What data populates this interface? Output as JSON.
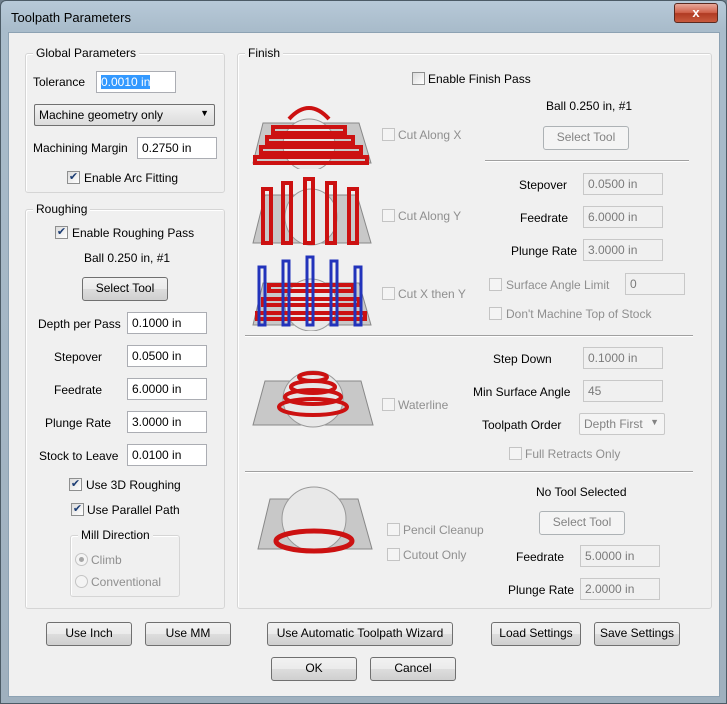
{
  "window": {
    "title": "Toolpath Parameters",
    "close_glyph": "x"
  },
  "global": {
    "title": "Global Parameters",
    "tolerance_label": "Tolerance",
    "tolerance_value": "0.0010 in",
    "geometry_select": "Machine geometry only",
    "margin_label": "Machining Margin",
    "margin_value": "0.2750 in",
    "arc_fitting_label": "Enable Arc Fitting",
    "arc_fitting_checked": true
  },
  "roughing": {
    "title": "Roughing",
    "enable_label": "Enable Roughing Pass",
    "enable_checked": true,
    "tool_name": "Ball 0.250 in, #1",
    "select_tool_label": "Select Tool",
    "depth_label": "Depth per Pass",
    "depth_value": "0.1000 in",
    "stepover_label": "Stepover",
    "stepover_value": "0.0500 in",
    "feedrate_label": "Feedrate",
    "feedrate_value": "6.0000 in",
    "plunge_label": "Plunge Rate",
    "plunge_value": "3.0000 in",
    "stock_label": "Stock to Leave",
    "stock_value": "0.0100 in",
    "use3d_label": "Use 3D Roughing",
    "use3d_checked": true,
    "parallel_label": "Use Parallel Path",
    "parallel_checked": true,
    "mill_direction": {
      "title": "Mill Direction",
      "climb_label": "Climb",
      "conventional_label": "Conventional",
      "selected": "Climb"
    }
  },
  "finish": {
    "title": "Finish",
    "enable_label": "Enable Finish Pass",
    "enable_checked": false,
    "tool_name": "Ball 0.250 in, #1",
    "select_tool_label": "Select Tool",
    "cut_x_label": "Cut Along X",
    "cut_y_label": "Cut Along Y",
    "cut_xy_label": "Cut X then Y",
    "stepover_label": "Stepover",
    "stepover_value": "0.0500 in",
    "feedrate_label": "Feedrate",
    "feedrate_value": "6.0000 in",
    "plunge_label": "Plunge Rate",
    "plunge_value": "3.0000 in",
    "surface_limit_label": "Surface Angle Limit",
    "surface_limit_value": "0",
    "dont_machine_label": "Don't Machine Top of Stock",
    "waterline_label": "Waterline",
    "step_down_label": "Step Down",
    "step_down_value": "0.1000 in",
    "min_angle_label": "Min Surface Angle",
    "min_angle_value": "45",
    "order_label": "Toolpath Order",
    "order_value": "Depth First",
    "full_retracts_label": "Full Retracts Only",
    "pencil_tool_name": "No Tool Selected",
    "pencil_select_tool_label": "Select Tool",
    "pencil_label": "Pencil Cleanup",
    "cutout_label": "Cutout Only",
    "pencil_feedrate_label": "Feedrate",
    "pencil_feedrate_value": "5.0000 in",
    "pencil_plunge_label": "Plunge Rate",
    "pencil_plunge_value": "2.0000 in"
  },
  "footer": {
    "use_inch": "Use Inch",
    "use_mm": "Use MM",
    "wizard": "Use Automatic Toolpath Wizard",
    "load": "Load Settings",
    "save": "Save Settings",
    "ok": "OK",
    "cancel": "Cancel"
  },
  "colors": {
    "toolpath_red": "#cc1111",
    "toolpath_blue": "#2233bb",
    "selection": "#3399ff"
  },
  "icons": [
    "close-icon",
    "check-icon",
    "dropdown-arrow-icon"
  ]
}
